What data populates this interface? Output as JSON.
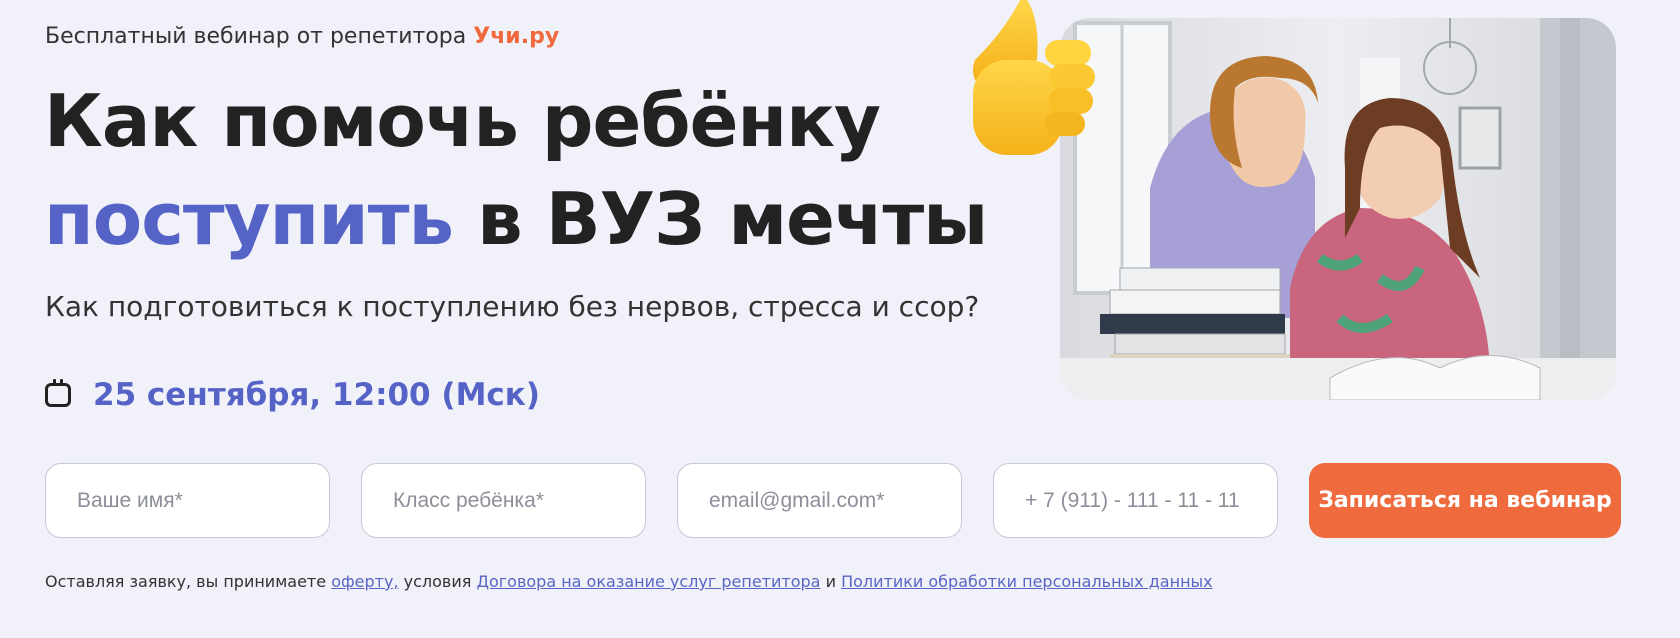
{
  "header": {
    "eyebrow_text": "Бесплатный вебинар от репетитора",
    "brand": "Учи.ру",
    "title_line1": "Как помочь ребёнку",
    "title_accent": "поступить",
    "title_rest": "в ВУЗ мечты",
    "subtitle": "Как подготовиться к поступлению без нервов, стресса и ссор?",
    "date": "25 сентября, 12:00 (Мск)"
  },
  "form": {
    "name_placeholder": "Ваше имя*",
    "class_placeholder": "Класс ребёнка*",
    "email_placeholder": "email@gmail.com*",
    "phone_placeholder": "+ 7 (911) - 111 - 11 - 11",
    "submit_label": "Записаться на вебинар"
  },
  "legal": {
    "prefix": "Оставляя заявку, вы принимаете",
    "offer_link": "оферту,",
    "middle": "условия",
    "contract_link": "Договора на оказание услуг репетитора",
    "and": "и",
    "policy_link": "Политики обработки персональных данных"
  },
  "icons": {
    "calendar": "calendar-icon",
    "thumbs_up": "thumbs-up-icon"
  },
  "colors": {
    "accent_blue": "#5563c6",
    "accent_orange": "#ef6a3c",
    "background": "#f0f1f9"
  }
}
